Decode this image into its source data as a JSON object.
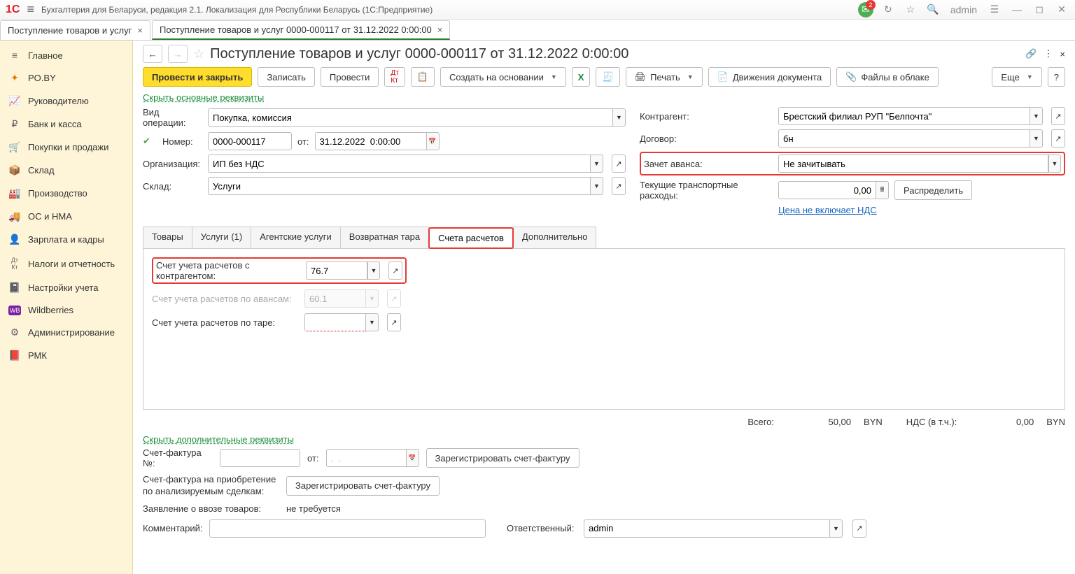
{
  "app": {
    "title": "Бухгалтерия для Беларуси, редакция 2.1. Локализация для Республики Беларусь  (1С:Предприятие)",
    "user": "admin",
    "notif_count": "2"
  },
  "doc_tabs": [
    {
      "label": "Поступление товаров и услуг"
    },
    {
      "label": "Поступление товаров и услуг 0000-000117 от 31.12.2022 0:00:00"
    }
  ],
  "sidebar": [
    {
      "icon": "≡",
      "label": "Главное"
    },
    {
      "icon": "✦",
      "label": "PO.BY",
      "color": "#e07b00"
    },
    {
      "icon": "📈",
      "label": "Руководителю"
    },
    {
      "icon": "₽",
      "label": "Банк и касса"
    },
    {
      "icon": "🛒",
      "label": "Покупки и продажи"
    },
    {
      "icon": "📦",
      "label": "Склад"
    },
    {
      "icon": "🏭",
      "label": "Производство"
    },
    {
      "icon": "🚚",
      "label": "ОС и НМА"
    },
    {
      "icon": "👤",
      "label": "Зарплата и кадры"
    },
    {
      "icon": "Дт",
      "label": "Налоги и отчетность"
    },
    {
      "icon": "📓",
      "label": "Настройки учета"
    },
    {
      "icon": "WB",
      "label": "Wildberries",
      "bg": "#7b1fa2"
    },
    {
      "icon": "⚙",
      "label": "Администрирование"
    },
    {
      "icon": "📕",
      "label": "РМК"
    }
  ],
  "page": {
    "title": "Поступление товаров и услуг 0000-000117 от 31.12.2022 0:00:00",
    "hide_req": "Скрыть основные реквизиты",
    "hide_add": "Скрыть дополнительные реквизиты"
  },
  "toolbar": {
    "post_close": "Провести и закрыть",
    "write": "Записать",
    "post": "Провести",
    "create_based": "Создать на основании",
    "print": "Печать",
    "movements": "Движения документа",
    "files": "Файлы в облаке",
    "more": "Еще"
  },
  "form": {
    "op_type_lbl": "Вид операции:",
    "op_type": "Покупка, комиссия",
    "number_lbl": "Номер:",
    "number": "0000-000117",
    "from_lbl": "от:",
    "date": "31.12.2022  0:00:00",
    "org_lbl": "Организация:",
    "org": "ИП без НДС",
    "warehouse_lbl": "Склад:",
    "warehouse": "Услуги",
    "counterparty_lbl": "Контрагент:",
    "counterparty": "Брестский филиал РУП \"Белпочта\"",
    "contract_lbl": "Договор:",
    "contract": "бн",
    "advance_lbl": "Зачет аванса:",
    "advance": "Не зачитывать",
    "transport_lbl": "Текущие транспортные расходы:",
    "transport": "0,00",
    "distribute": "Распределить",
    "vat_link": "Цена не включает НДС"
  },
  "subtabs": {
    "t1": "Товары",
    "t2": "Услуги (1)",
    "t3": "Агентские услуги",
    "t4": "Возвратная тара",
    "t5": "Счета расчетов",
    "t6": "Дополнительно"
  },
  "accounts": {
    "lbl1": "Счет учета расчетов с контрагентом:",
    "val1": "76.7",
    "lbl2": "Счет учета расчетов по авансам:",
    "val2": "60.1",
    "lbl3": "Счет учета расчетов по таре:",
    "val3": ""
  },
  "totals": {
    "total_lbl": "Всего:",
    "total": "50,00",
    "cur": "BYN",
    "vat_lbl": "НДС (в т.ч.):",
    "vat": "0,00"
  },
  "footer": {
    "sf_num_lbl": "Счет-фактура №:",
    "sf_from": "от:",
    "sf_date": ".  .",
    "reg_sf": "Зарегистрировать счет-фактуру",
    "sf_purchase_lbl1": "Счет-фактура на приобретение",
    "sf_purchase_lbl2": "по анализируемым сделкам:",
    "import_lbl": "Заявление о ввозе товаров:",
    "import_val": "не требуется",
    "comment_lbl": "Комментарий:",
    "responsible_lbl": "Ответственный:",
    "responsible": "admin"
  }
}
